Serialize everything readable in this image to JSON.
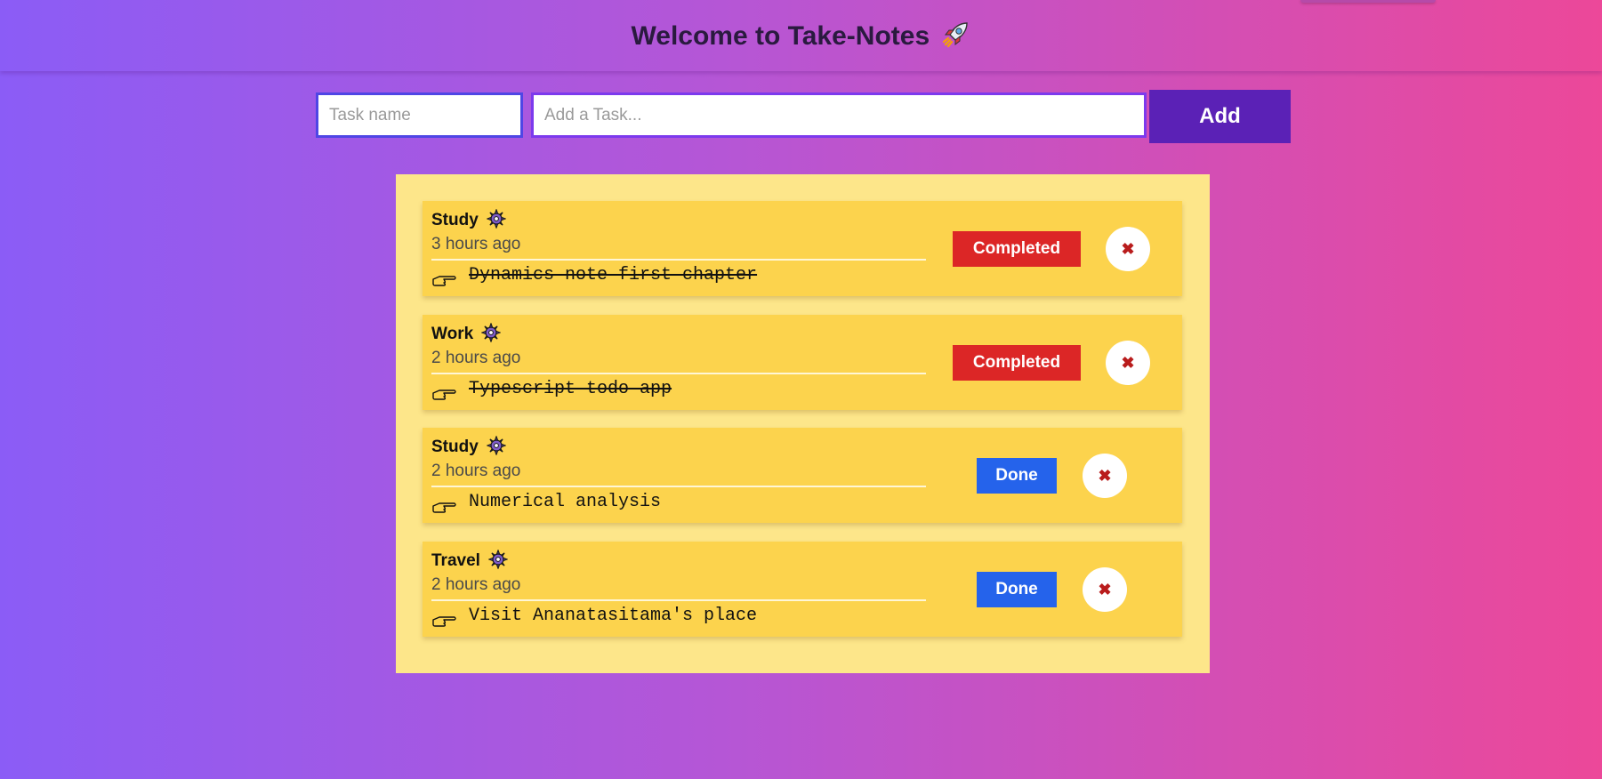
{
  "header": {
    "title": "Welcome to Take-Notes",
    "title_icon": "rocket-icon"
  },
  "form": {
    "task_name_placeholder": "Task name",
    "task_placeholder": "Add a Task...",
    "add_label": "Add"
  },
  "tasks": [
    {
      "category": "Study",
      "time": "3 hours ago",
      "text": "Dynamics note first chapter",
      "completed": true,
      "status_label": "Completed",
      "delete_label": "✖"
    },
    {
      "category": "Work",
      "time": "2 hours ago",
      "text": "Typescript todo app",
      "completed": true,
      "status_label": "Completed",
      "delete_label": "✖"
    },
    {
      "category": "Study",
      "time": "2 hours ago",
      "text": "Numerical analysis",
      "completed": false,
      "status_label": "Done",
      "delete_label": "✖"
    },
    {
      "category": "Travel",
      "time": "2 hours ago",
      "text": "Visit Ananatasitama's place",
      "completed": false,
      "status_label": "Done",
      "delete_label": "✖"
    }
  ],
  "colors": {
    "completed_button": "#dc2626",
    "done_button": "#2563eb",
    "add_button": "#5b21b6",
    "board": "#fde68a",
    "card": "#fcd34d"
  }
}
